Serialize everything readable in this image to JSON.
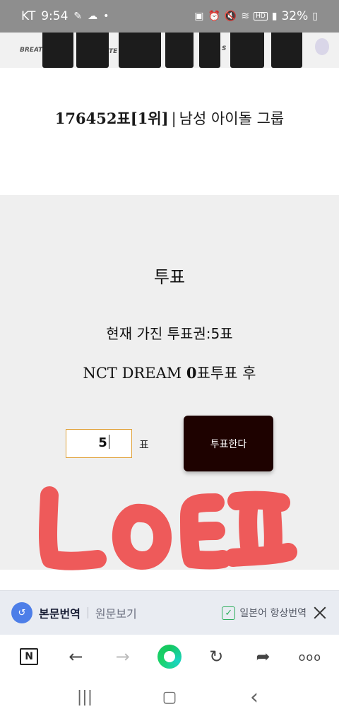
{
  "status_bar": {
    "carrier": "KT",
    "time": "9:54",
    "network": "HD",
    "battery": "32%"
  },
  "banner": {
    "left_text": "BREATE",
    "mid_text": "TE",
    "right_text": "S"
  },
  "title": {
    "count": "176452표[1위]",
    "separator": "|",
    "category": "남성 아이돌 그룹"
  },
  "vote": {
    "heading": "투표",
    "tickets": "현재 가진 투표권:5표",
    "status_name": "NCT DREAM ",
    "status_count": "0",
    "status_suffix": "표투표 후",
    "input_value": "5",
    "unit": "표",
    "button": "투표한다",
    "doodle_color": "#ee5a5a"
  },
  "translate_bar": {
    "active": "본문번역",
    "original": "원문보기",
    "always": "일본어 항상번역",
    "check_color": "#2fae5d"
  },
  "browser_bar": {
    "n_label": "N",
    "back": "←",
    "forward": "→",
    "refresh": "↻",
    "share": "➦",
    "more": "ooo"
  },
  "nav_bar": {
    "recents": "|||",
    "home": "▢",
    "back": "‹"
  }
}
